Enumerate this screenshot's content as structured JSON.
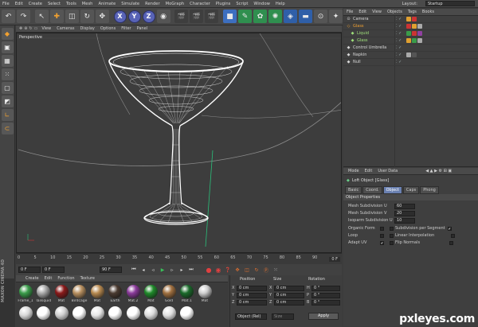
{
  "menubar": {
    "items": [
      "File",
      "Edit",
      "Create",
      "Select",
      "Tools",
      "Mesh",
      "Animate",
      "Simulate",
      "Render",
      "MoGraph",
      "Character",
      "Plugins",
      "Script",
      "Window",
      "Help"
    ],
    "layout_label": "Layout:",
    "layout_value": "Startup"
  },
  "toolbar": {
    "axes": [
      "X",
      "Y",
      "Z"
    ]
  },
  "viewport": {
    "menu": [
      "View",
      "Cameras",
      "Display",
      "Options",
      "Filter",
      "Panel"
    ],
    "label": "Perspective"
  },
  "timeline": {
    "ticks": [
      "0",
      "5",
      "10",
      "15",
      "20",
      "25",
      "30",
      "35",
      "40",
      "45",
      "50",
      "55",
      "60",
      "65",
      "70",
      "75",
      "80",
      "85",
      "90"
    ],
    "end_frame": "0 F",
    "current_frame": "0 F",
    "start_field": "0 F",
    "end_field": "90 F"
  },
  "object_manager": {
    "menu": [
      "File",
      "Edit",
      "View",
      "Objects",
      "Tags",
      "Books"
    ],
    "objects": [
      {
        "name": "Camera",
        "color": "#d8d8d8",
        "indent": 0
      },
      {
        "name": "Glass",
        "color": "#f0a030",
        "indent": 0
      },
      {
        "name": "Liquid",
        "color": "#9ee07a",
        "indent": 1
      },
      {
        "name": "Glass",
        "color": "#9ee07a",
        "indent": 1
      },
      {
        "name": "Control Umbrella",
        "color": "#d8d8d8",
        "indent": 0
      },
      {
        "name": "Napkin",
        "color": "#d8d8d8",
        "indent": 0
      },
      {
        "name": "Null",
        "color": "#d8d8d8",
        "indent": 0
      }
    ]
  },
  "attributes": {
    "menu": [
      "Mode",
      "Edit",
      "User Data"
    ],
    "title": "Loft Object [Glass]",
    "tabs": [
      "Basic",
      "Coord.",
      "Object",
      "Caps",
      "Phong"
    ],
    "active_tab": "Object",
    "section": "Object Properties",
    "props": {
      "mesh_u": {
        "label": "Mesh Subdivision U",
        "value": "60"
      },
      "mesh_v": {
        "label": "Mesh Subdivision V",
        "value": "20"
      },
      "iso_u": {
        "label": "Isoparm Subdivision U",
        "value": "10"
      },
      "organic": {
        "label": "Organic Form",
        "checked": false
      },
      "loop": {
        "label": "Loop",
        "checked": false
      },
      "adapt_uv": {
        "label": "Adapt UV",
        "checked": true
      },
      "subdiv_seg": {
        "label": "Subdivision per Segment",
        "checked": true
      },
      "linear": {
        "label": "Linear Interpolation",
        "checked": false
      },
      "flip": {
        "label": "Flip Normals",
        "checked": false
      }
    }
  },
  "materials": {
    "menu": [
      "Create",
      "Edit",
      "Function",
      "Texture"
    ],
    "row1": [
      {
        "name": "Frame_1",
        "color": "#3a9c4a"
      },
      {
        "name": "Tailsquid",
        "color": "#aaaaaa"
      },
      {
        "name": "Mat",
        "color": "#8a1a1a"
      },
      {
        "name": "Birdcage",
        "color": "#b89060"
      },
      {
        "name": "Mat",
        "color": "#b88a50"
      },
      {
        "name": "Earth",
        "color": "#4a3a30"
      },
      {
        "name": "Mat.2",
        "color": "#8a3a9a"
      },
      {
        "name": "Mat",
        "color": "#1f8a2a"
      },
      {
        "name": "Gold",
        "color": "#a07040"
      },
      {
        "name": "Mat.1",
        "color": "#1a6a2a"
      },
      {
        "name": "Mat",
        "color": "#cfcfcf"
      }
    ],
    "row2_colors": [
      "#d8d8d8",
      "#ffffff",
      "#d0d0d0",
      "#ffffff",
      "#e8e8e8",
      "#ffffff",
      "#ffffff",
      "#dddddd",
      "#e0e0e0",
      "#ffffff"
    ],
    "brand": "MAXON CINEMA 4D"
  },
  "coordinates": {
    "headers": [
      "Position",
      "Size",
      "Rotation"
    ],
    "rows": [
      {
        "axis": "X",
        "pos": "0 cm",
        "size": "0 cm",
        "rot_axis": "H",
        "rot": "0 °"
      },
      {
        "axis": "Y",
        "pos": "0 cm",
        "size": "0 cm",
        "rot_axis": "P",
        "rot": "0 °"
      },
      {
        "axis": "Z",
        "pos": "0 cm",
        "size": "0 cm",
        "rot_axis": "B",
        "rot": "0 °"
      }
    ],
    "mode": "Object (Rel)",
    "size_mode": "Size",
    "apply": "Apply"
  },
  "watermark": "pxleyes.com",
  "colors": {
    "wire": "#ffffff",
    "y_axis": "#2ac07a",
    "accent": "#6a80b0"
  }
}
